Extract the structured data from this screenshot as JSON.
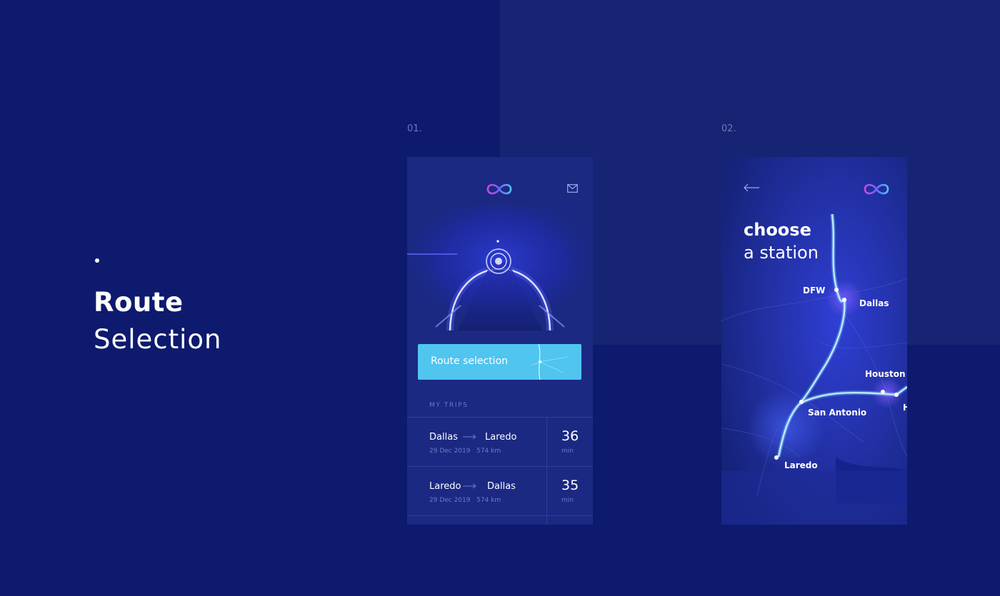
{
  "hero": {
    "title_bold": "Route",
    "title_light": "Selection"
  },
  "steps": {
    "first": "01.",
    "second": "02."
  },
  "screen1": {
    "logo_icon": "infinity-logo-icon",
    "mail_icon": "mail-icon",
    "route_button_label": "Route selection",
    "trips_heading": "MY TRIPS",
    "trips": [
      {
        "from": "Dallas",
        "to": "Laredo",
        "date": "29 Dec 2019",
        "distance": "574 km",
        "duration": "36",
        "unit": "min"
      },
      {
        "from": "Laredo",
        "to": "Dallas",
        "date": "29 Dec 2019",
        "distance": "574 km",
        "duration": "35",
        "unit": "min"
      }
    ]
  },
  "screen2": {
    "back_icon": "arrow-left-icon",
    "logo_icon": "infinity-logo-icon",
    "heading_bold": "choose",
    "heading_light": "a station",
    "stations": {
      "dfw": "DFW",
      "dallas": "Dallas",
      "houston": "Houston",
      "san_antonio": "San Antonio",
      "laredo": "Laredo",
      "partial": "H P"
    }
  },
  "colors": {
    "background": "#0e1a6d",
    "panel": "#172474",
    "accent": "#4fc5f0",
    "route_line": "#7fd8ff"
  }
}
